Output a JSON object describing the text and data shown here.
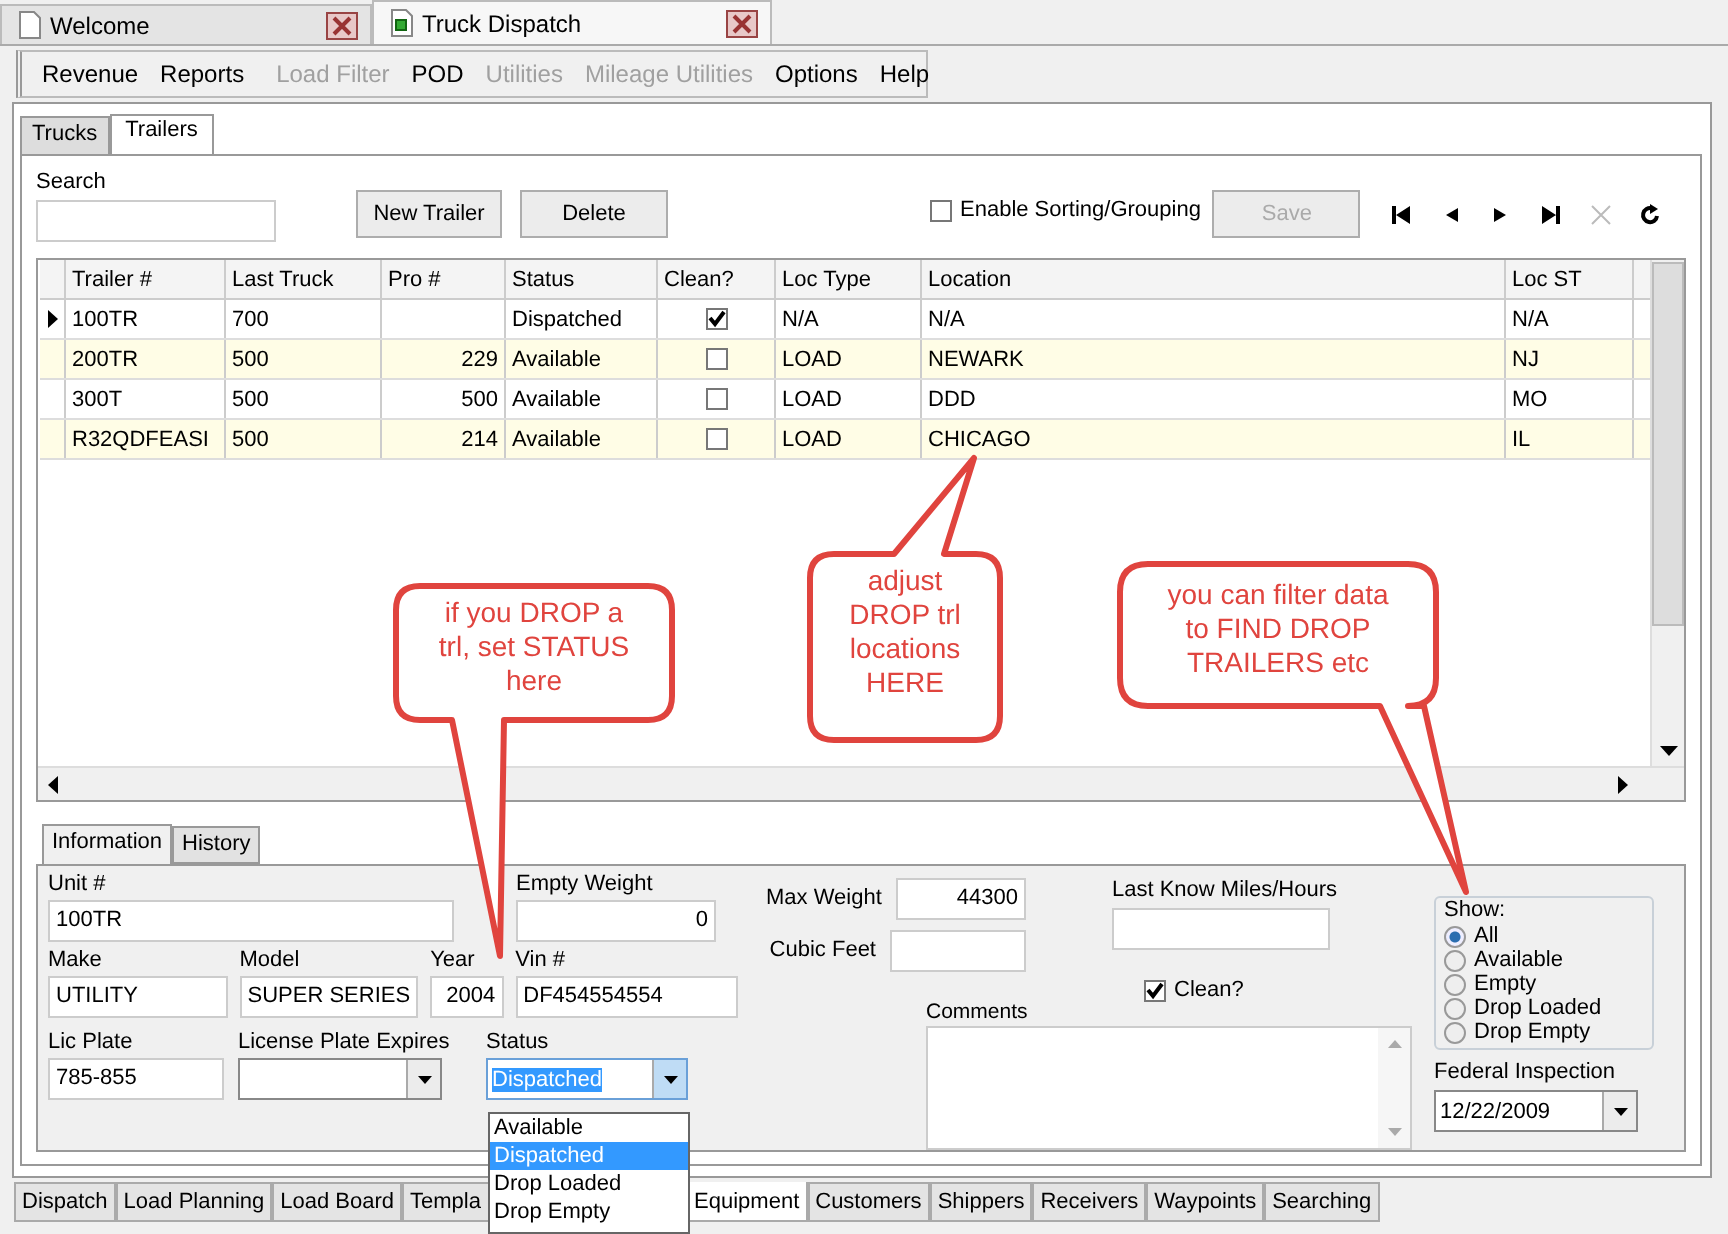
{
  "doc_tabs": [
    {
      "label": "Welcome",
      "selected": false
    },
    {
      "label": "Truck Dispatch",
      "selected": true
    }
  ],
  "menu": [
    {
      "label": "Revenue",
      "disabled": false
    },
    {
      "label": "Reports",
      "disabled": false
    },
    {
      "label": "Load Filter",
      "disabled": true
    },
    {
      "label": "POD",
      "disabled": false
    },
    {
      "label": "Utilities",
      "disabled": true
    },
    {
      "label": "Mileage Utilities",
      "disabled": true
    },
    {
      "label": "Options",
      "disabled": false
    },
    {
      "label": "Help",
      "disabled": false
    }
  ],
  "view_tabs": [
    {
      "label": "Trucks",
      "selected": false
    },
    {
      "label": "Trailers",
      "selected": true
    }
  ],
  "search": {
    "label": "Search"
  },
  "actions": [
    {
      "label": "New Trailer",
      "disabled": false
    },
    {
      "label": "Delete",
      "disabled": false
    }
  ],
  "enable_sorting": {
    "label": "Enable Sorting/Grouping",
    "checked": false
  },
  "save": {
    "label": "Save",
    "disabled": true
  },
  "navigator": [
    {
      "kind": "first",
      "disabled": false
    },
    {
      "kind": "prev",
      "disabled": false
    },
    {
      "kind": "next",
      "disabled": false
    },
    {
      "kind": "last",
      "disabled": false
    },
    {
      "kind": "cancel",
      "disabled": true
    },
    {
      "kind": "refresh",
      "disabled": false
    }
  ],
  "grid": {
    "columns": [
      "Trailer #",
      "Last Truck",
      "Pro #",
      "Status",
      "Clean?",
      "Loc Type",
      "Location",
      "Loc ST"
    ],
    "rows": [
      {
        "current": true,
        "trailer": "100TR",
        "last_truck": "700",
        "status": "Dispatched",
        "clean": true,
        "loc_type": "N/A",
        "location": "N/A",
        "loc_st": "N/A"
      },
      {
        "current": false,
        "trailer": "200TR",
        "last_truck": "500",
        "pro": "229",
        "status": "Available",
        "clean": false,
        "loc_type": "LOAD",
        "location": "NEWARK",
        "loc_st": "NJ"
      },
      {
        "current": false,
        "trailer": "300T",
        "last_truck": "500",
        "pro": "500",
        "status": "Available",
        "clean": false,
        "loc_type": "LOAD",
        "location": "DDD",
        "loc_st": "MO"
      },
      {
        "current": false,
        "trailer": "R32QDFEASI",
        "last_truck": "500",
        "pro": "214",
        "status": "Available",
        "clean": false,
        "loc_type": "LOAD",
        "location": "CHICAGO",
        "loc_st": "IL"
      }
    ]
  },
  "detail_tabs": [
    {
      "label": "Information",
      "selected": true
    },
    {
      "label": "History",
      "selected": false
    }
  ],
  "fields": {
    "unit": {
      "label": "Unit #",
      "value": "100TR"
    },
    "empty_weight": {
      "label": "Empty Weight",
      "value": "0"
    },
    "make": {
      "label": "Make",
      "value": "UTILITY"
    },
    "model": {
      "label": "Model",
      "value": "SUPER SERIES"
    },
    "year": {
      "label": "Year",
      "value": "2004"
    },
    "vin": {
      "label": "Vin #",
      "value": "DF454554554"
    },
    "lic_plate": {
      "label": "Lic Plate",
      "value": "785-855"
    },
    "plate_expires": {
      "label": "License Plate Expires"
    },
    "status": {
      "label": "Status",
      "value": "Dispatched",
      "expanded": true,
      "options": [
        {
          "label": "Available",
          "selected": false
        },
        {
          "label": "Dispatched",
          "selected": true
        },
        {
          "label": "Drop Loaded",
          "selected": false
        },
        {
          "label": "Drop Empty",
          "selected": false
        }
      ]
    },
    "max_weight": {
      "label": "Max Weight",
      "value": "44300"
    },
    "cubic_feet": {
      "label": "Cubic Feet"
    },
    "last_miles": {
      "label": "Last Know Miles/Hours"
    },
    "clean": {
      "label": "Clean?",
      "checked": true
    },
    "comments": {
      "label": "Comments"
    },
    "show": {
      "label": "Show:",
      "options": [
        {
          "label": "All",
          "selected": true
        },
        {
          "label": "Available",
          "selected": false
        },
        {
          "label": "Empty",
          "selected": false
        },
        {
          "label": "Drop Loaded",
          "selected": false
        },
        {
          "label": "Drop Empty",
          "selected": false
        }
      ]
    },
    "federal_inspection": {
      "label": "Federal Inspection",
      "value": "12/22/2009"
    }
  },
  "bottom_tabs": [
    {
      "label": "Dispatch",
      "selected": false
    },
    {
      "label": "Load Planning",
      "selected": false
    },
    {
      "label": "Load Board",
      "selected": false
    },
    {
      "label": "Templa",
      "selected": false
    },
    {
      "label": "Equipment",
      "selected": true
    },
    {
      "label": "Customers",
      "selected": false
    },
    {
      "label": "Shippers",
      "selected": false
    },
    {
      "label": "Receivers",
      "selected": false
    },
    {
      "label": "Waypoints",
      "selected": false
    },
    {
      "label": "Searching",
      "selected": false
    }
  ],
  "callouts": [
    {
      "text": "if you DROP a\ntrl, set STATUS\nhere"
    },
    {
      "text": "adjust\nDROP trl\nlocations\nHERE"
    },
    {
      "text": "you can filter data\nto FIND DROP\nTRAILERS etc"
    }
  ]
}
